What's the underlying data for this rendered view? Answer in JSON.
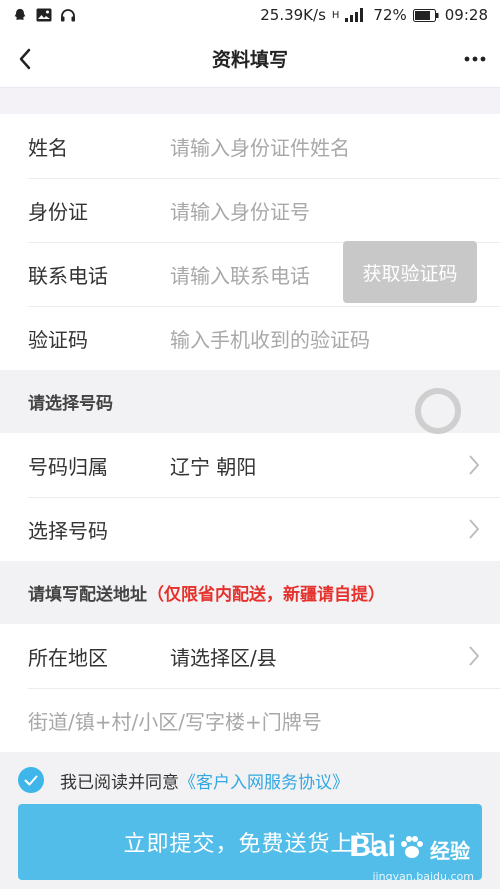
{
  "status_bar": {
    "speed": "25.39K/s",
    "signal": "H",
    "battery": "72%",
    "time": "09:28"
  },
  "nav": {
    "title": "资料填写"
  },
  "personal": {
    "name_label": "姓名",
    "name_placeholder": "请输入身份证件姓名",
    "id_label": "身份证",
    "id_placeholder": "请输入身份证号",
    "phone_label": "联系电话",
    "phone_placeholder": "请输入联系电话",
    "get_code_button": "获取验证码",
    "code_label": "验证码",
    "code_placeholder": "输入手机收到的验证码"
  },
  "number_section": {
    "header": "请选择号码",
    "region_label": "号码归属",
    "region_value": "辽宁 朝阳",
    "select_label": "选择号码"
  },
  "address_section": {
    "header": "请填写配送地址",
    "note": "（仅限省内配送，新疆请自提）",
    "area_label": "所在地区",
    "area_value": "请选择区/县",
    "street_placeholder": "街道/镇+村/小区/写字楼+门牌号"
  },
  "agreement": {
    "text": "我已阅读并同意",
    "link": "《客户入网服务协议》",
    "checked": true
  },
  "submit": {
    "label": "立即提交，免费送货上门"
  },
  "watermark": {
    "brand": "Bai",
    "brand_suffix": "经验",
    "url": "jingyan.baidu.com"
  },
  "colors": {
    "accent": "#52bde9",
    "link": "#33a8e0",
    "warning": "#e5322d",
    "disabled_button": "#c8c8c8"
  }
}
